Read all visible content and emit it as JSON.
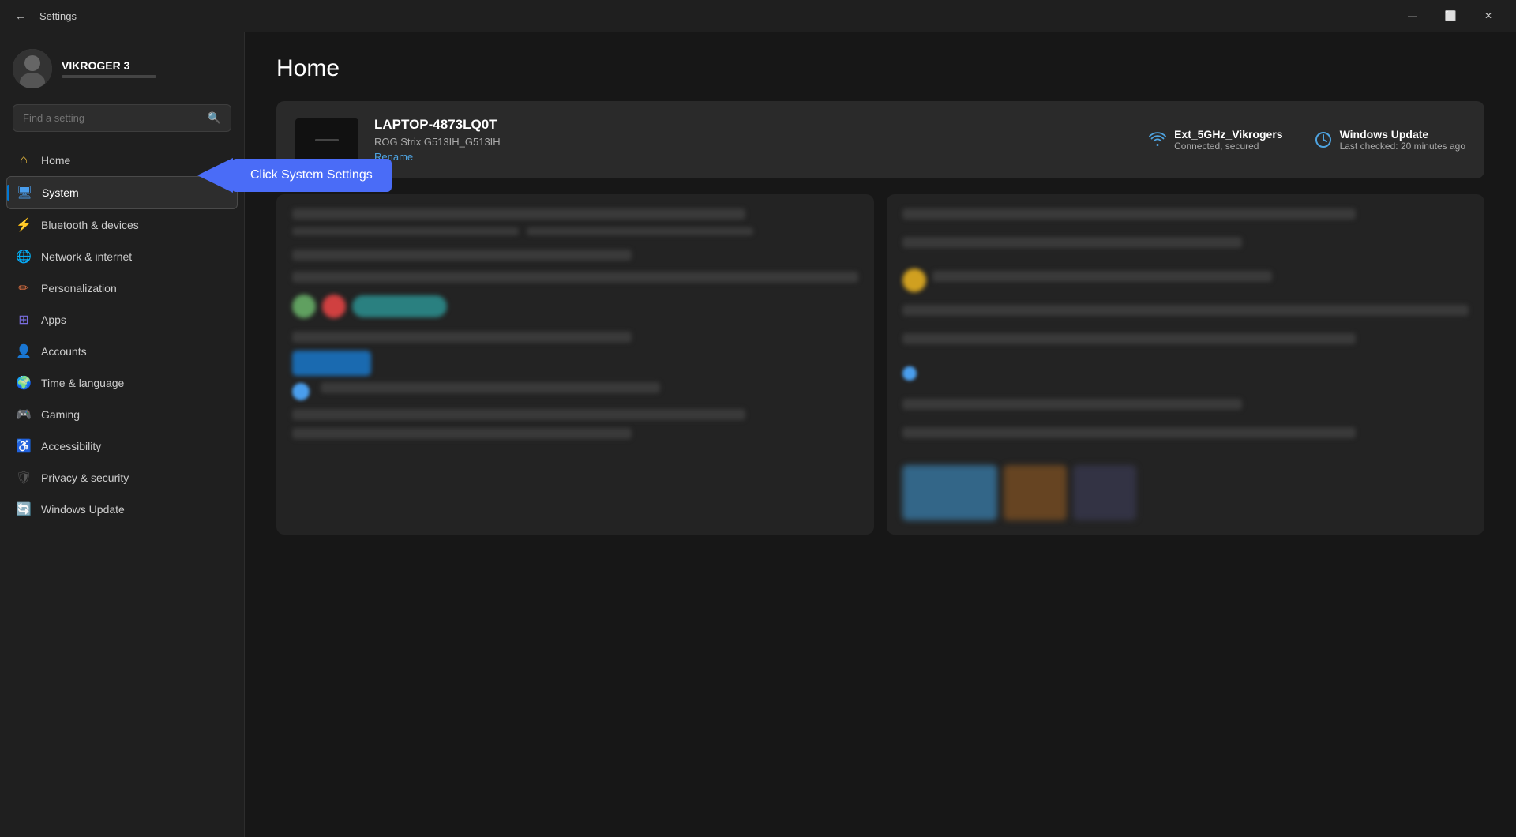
{
  "titlebar": {
    "title": "Settings",
    "back_label": "←",
    "minimize": "—",
    "maximize": "⬜",
    "close": "✕"
  },
  "user": {
    "name": "VIKROGER 3"
  },
  "search": {
    "placeholder": "Find a setting"
  },
  "nav": {
    "items": [
      {
        "id": "home",
        "label": "Home",
        "icon": "⌂",
        "iconClass": "icon-home",
        "active": false
      },
      {
        "id": "system",
        "label": "System",
        "icon": "🖥",
        "iconClass": "icon-system",
        "active": true
      },
      {
        "id": "bluetooth",
        "label": "Bluetooth & devices",
        "icon": "⚡",
        "iconClass": "icon-bluetooth",
        "active": false
      },
      {
        "id": "network",
        "label": "Network & internet",
        "icon": "🌐",
        "iconClass": "icon-network",
        "active": false
      },
      {
        "id": "personalization",
        "label": "Personalization",
        "icon": "✏",
        "iconClass": "icon-personalization",
        "active": false
      },
      {
        "id": "apps",
        "label": "Apps",
        "icon": "⊞",
        "iconClass": "icon-apps",
        "active": false
      },
      {
        "id": "accounts",
        "label": "Accounts",
        "icon": "👤",
        "iconClass": "icon-accounts",
        "active": false
      },
      {
        "id": "time",
        "label": "Time & language",
        "icon": "🌍",
        "iconClass": "icon-time",
        "active": false
      },
      {
        "id": "gaming",
        "label": "Gaming",
        "icon": "🎮",
        "iconClass": "icon-gaming",
        "active": false
      },
      {
        "id": "accessibility",
        "label": "Accessibility",
        "icon": "♿",
        "iconClass": "icon-accessibility",
        "active": false
      },
      {
        "id": "privacy",
        "label": "Privacy & security",
        "icon": "🛡",
        "iconClass": "icon-privacy",
        "active": false
      },
      {
        "id": "update",
        "label": "Windows Update",
        "icon": "🔄",
        "iconClass": "icon-update",
        "active": false
      }
    ]
  },
  "main": {
    "page_title": "Home",
    "device": {
      "name": "LAPTOP-4873LQ0T",
      "model": "ROG Strix G513IH_G513IH",
      "rename_label": "Rename"
    },
    "wifi": {
      "label": "Ext_5GHz_Vikrogers",
      "sub": "Connected, secured"
    },
    "update": {
      "label": "Windows Update",
      "sub": "Last checked: 20 minutes ago"
    }
  },
  "annotation": {
    "label": "Click System Settings"
  }
}
